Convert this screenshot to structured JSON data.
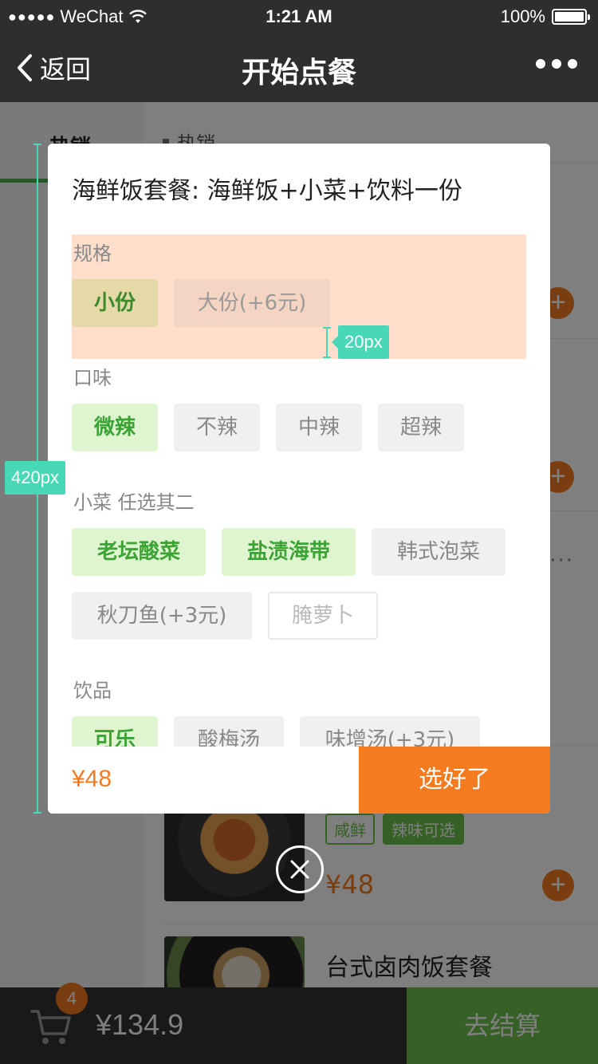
{
  "status_bar": {
    "carrier": "WeChat",
    "signal": "●●●●●",
    "time": "1:21 AM",
    "battery": "100%"
  },
  "nav": {
    "back_label": "返回",
    "title": "开始点餐"
  },
  "page": {
    "category": "热销",
    "section_header": "热销",
    "dishes": [
      {
        "tags": [
          "咸鲜",
          "辣味可选"
        ],
        "price": "¥48"
      },
      {
        "name": "台式卤肉饭套餐"
      }
    ]
  },
  "cart": {
    "count": "4",
    "total": "¥134.9",
    "checkout_label": "去结算"
  },
  "modal": {
    "title": "海鲜饭套餐: 海鲜饭+小菜+饮料一份",
    "sections": [
      {
        "label": "规格",
        "options": [
          "小份",
          "大份(+6元)"
        ]
      },
      {
        "label": "口味",
        "options": [
          "微辣",
          "不辣",
          "中辣",
          "超辣"
        ]
      },
      {
        "label": "小菜 任选其二",
        "options": [
          "老坛酸菜",
          "盐渍海带",
          "韩式泡菜",
          "秋刀鱼(+3元)",
          "腌萝卜"
        ]
      },
      {
        "label": "饮品",
        "options": [
          "可乐",
          "酸梅汤",
          "味增汤(+3元)"
        ]
      }
    ],
    "price": "¥48",
    "confirm_label": "选好了"
  },
  "annotations": {
    "height_label": "420px",
    "spacing_label": "20px",
    "color": "#48d8b8"
  },
  "colors": {
    "accent_orange": "#f47b20",
    "accent_green": "#6cc04a",
    "nav_bg": "#2e2e2e"
  }
}
